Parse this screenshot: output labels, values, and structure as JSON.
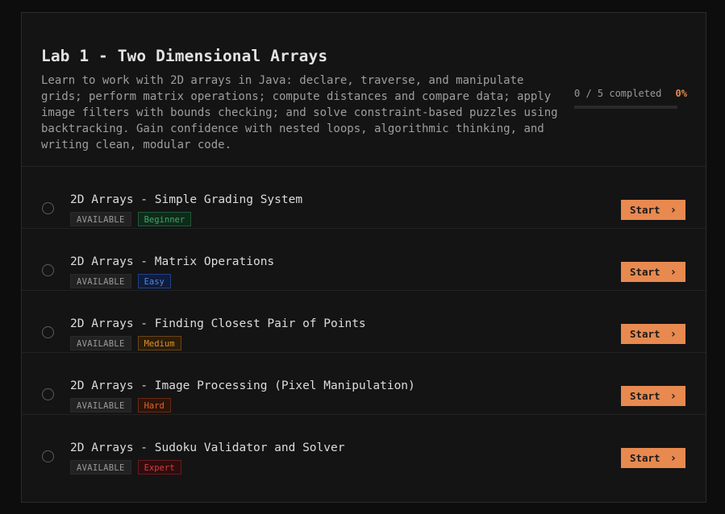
{
  "lab": {
    "title": "Lab 1 - Two Dimensional Arrays",
    "description": "Learn to work with 2D arrays in Java: declare, traverse, and manipulate grids; perform matrix operations; compute distances and compare data; apply image filters with bounds checking; and solve constraint-based puzzles using backtracking. Gain confidence with nested loops, algorithmic thinking, and writing clean, modular code.",
    "progress": {
      "completed_text": "0 / 5 completed",
      "percent_text": "0%",
      "fraction": 0
    }
  },
  "exercises": [
    {
      "title": "2D Arrays - Simple Grading System",
      "status": "AVAILABLE",
      "difficulty": "Beginner",
      "difficulty_color": "#3fa66a",
      "difficulty_bg": "#0f2a1b",
      "difficulty_border": "#1f5a36",
      "action": "Start",
      "chevron": "›"
    },
    {
      "title": "2D Arrays - Matrix Operations",
      "status": "AVAILABLE",
      "difficulty": "Easy",
      "difficulty_color": "#4f86e8",
      "difficulty_bg": "#101c3a",
      "difficulty_border": "#1f3f8a",
      "action": "Start",
      "chevron": "›"
    },
    {
      "title": "2D Arrays - Finding Closest Pair of Points",
      "status": "AVAILABLE",
      "difficulty": "Medium",
      "difficulty_color": "#e0902a",
      "difficulty_bg": "#2b1d0b",
      "difficulty_border": "#6a4413",
      "action": "Start",
      "chevron": "›"
    },
    {
      "title": "2D Arrays - Image Processing (Pixel Manipulation)",
      "status": "AVAILABLE",
      "difficulty": "Hard",
      "difficulty_color": "#e0652a",
      "difficulty_bg": "#2d140b",
      "difficulty_border": "#6a2a13",
      "action": "Start",
      "chevron": "›"
    },
    {
      "title": "2D Arrays - Sudoku Validator and Solver",
      "status": "AVAILABLE",
      "difficulty": "Expert",
      "difficulty_color": "#e03b3b",
      "difficulty_bg": "#2d0d0f",
      "difficulty_border": "#6a1a1e",
      "action": "Start",
      "chevron": "›"
    }
  ]
}
